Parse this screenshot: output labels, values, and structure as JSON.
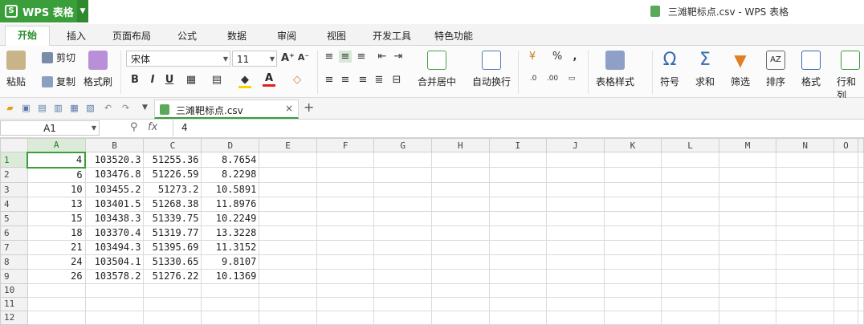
{
  "app": {
    "name": "WPS 表格"
  },
  "window": {
    "title": "三滩靶标点.csv - WPS 表格"
  },
  "menu_tabs": [
    "开始",
    "插入",
    "页面布局",
    "公式",
    "数据",
    "审阅",
    "视图",
    "开发工具",
    "特色功能"
  ],
  "ribbon": {
    "paste": "粘贴",
    "cut": "剪切",
    "copy": "复制",
    "format_painter": "格式刷",
    "font_name": "宋体",
    "font_size": "11",
    "merge_center": "合并居中",
    "wrap_text": "自动换行",
    "table_style": "表格样式",
    "symbol": "符号",
    "sum": "求和",
    "filter": "筛选",
    "sort": "排序",
    "format": "格式",
    "rows_cols": "行和列"
  },
  "document_tab": {
    "name": "三滩靶标点.csv"
  },
  "formula_bar": {
    "name_box": "A1",
    "fx": "fx",
    "value": "4"
  },
  "sheet": {
    "columns": [
      "A",
      "B",
      "C",
      "D",
      "E",
      "F",
      "G",
      "H",
      "I",
      "J",
      "K",
      "L",
      "M",
      "N",
      "O"
    ],
    "row_numbers": [
      "1",
      "2",
      "3",
      "4",
      "5",
      "6",
      "7",
      "8",
      "9",
      "10",
      "11",
      "12"
    ],
    "rows": [
      [
        "4",
        "103520.3",
        "51255.36",
        "8.7654"
      ],
      [
        "6",
        "103476.8",
        "51226.59",
        "8.2298"
      ],
      [
        "10",
        "103455.2",
        "51273.2",
        "10.5891"
      ],
      [
        "13",
        "103401.5",
        "51268.38",
        "11.8976"
      ],
      [
        "15",
        "103438.3",
        "51339.75",
        "10.2249"
      ],
      [
        "18",
        "103370.4",
        "51319.77",
        "13.3228"
      ],
      [
        "21",
        "103494.3",
        "51395.69",
        "11.3152"
      ],
      [
        "24",
        "103504.1",
        "51330.65",
        "9.8107"
      ],
      [
        "26",
        "103578.2",
        "51276.22",
        "10.1369"
      ]
    ]
  }
}
